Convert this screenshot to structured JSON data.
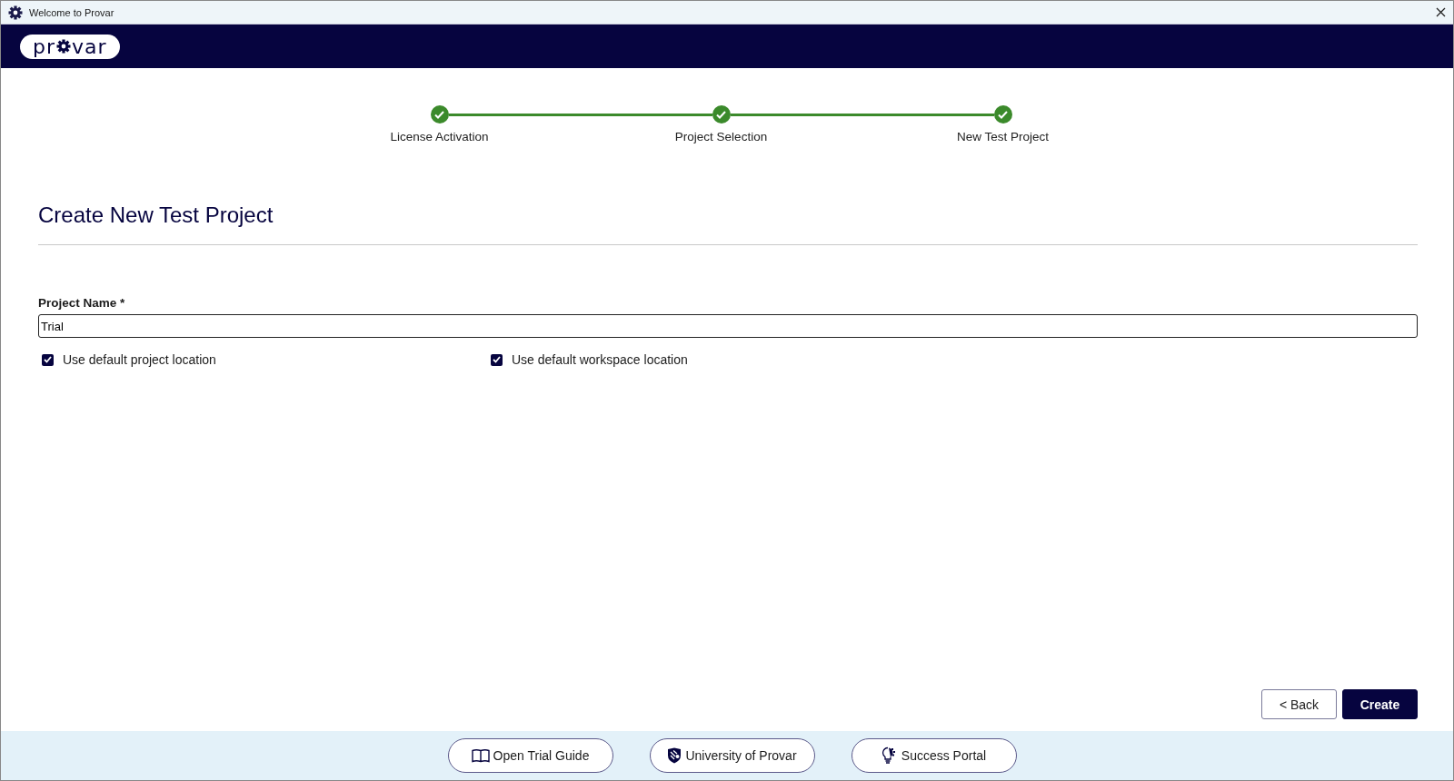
{
  "window": {
    "title": "Welcome to Provar"
  },
  "logo": {
    "text_start": "pr",
    "text_end": "var"
  },
  "steps": [
    {
      "label": "License Activation",
      "done": true
    },
    {
      "label": "Project Selection",
      "done": true
    },
    {
      "label": "New Test Project",
      "done": true
    }
  ],
  "heading": "Create New Test Project",
  "project_name": {
    "label": "Project Name *",
    "value": "Trial"
  },
  "options": [
    {
      "kind": "checkbox",
      "label": "Use default project location",
      "checked": true
    },
    {
      "kind": "checkbox",
      "label": "Use default workspace location",
      "checked": true
    }
  ],
  "actions": [
    {
      "kind": "secondary",
      "label": "< Back"
    },
    {
      "kind": "primary",
      "label": "Create"
    }
  ],
  "footer_links": [
    {
      "label": "Open Trial Guide"
    },
    {
      "label": "University of Provar"
    },
    {
      "label": "Success Portal"
    }
  ]
}
